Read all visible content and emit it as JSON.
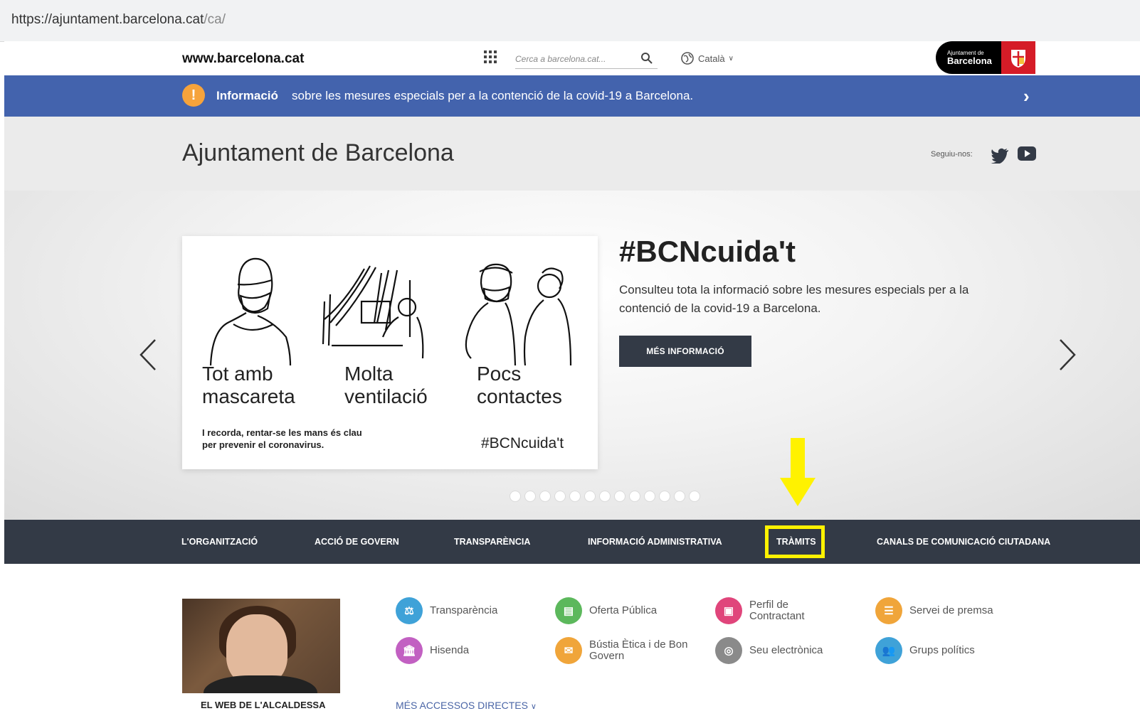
{
  "browser": {
    "url_host": "https://ajuntament.barcelona.cat",
    "url_path": "/ca/"
  },
  "topbar": {
    "site_label": "www.barcelona.cat",
    "search_placeholder": "Cerca a barcelona.cat...",
    "language": "Català",
    "logo_line1": "Ajuntament de",
    "logo_line2": "Barcelona"
  },
  "banner": {
    "title": "Informació",
    "text": "sobre les mesures especials per a la contenció de la covid-19 a Barcelona.",
    "color": "#4363ad"
  },
  "header": {
    "title": "Ajuntament de Barcelona",
    "follow_label": "Seguiu-nos:"
  },
  "hero": {
    "card": {
      "caption1_line1": "Tot amb",
      "caption1_line2": "mascareta",
      "caption2_line1": "Molta",
      "caption2_line2": "ventilació",
      "caption3_line1": "Pocs",
      "caption3_line2": "contactes",
      "note_line1": "I recorda, rentar-se les mans és clau",
      "note_line2": "per prevenir el coronavirus.",
      "hashtag": "#BCNcuida't"
    },
    "headline": "#BCNcuida't",
    "description": "Consulteu tota la informació sobre les mesures especials per a la contenció de la covid-19 a Barcelona.",
    "button": "MÉS INFORMACIÓ",
    "slide_count": 13
  },
  "nav": {
    "items": [
      "L'ORGANITZACIÓ",
      "ACCIÓ DE GOVERN",
      "TRANSPARÈNCIA",
      "INFORMACIÓ ADMINISTRATIVA",
      "TRÀMITS",
      "CANALS DE COMUNICACIÓ CIUTADANA"
    ],
    "highlighted": "TRÀMITS",
    "highlight_color": "#fff200"
  },
  "mayor": {
    "label": "EL WEB DE L'ALCALDESSA"
  },
  "access": {
    "items": [
      {
        "label": "Transparència",
        "icon": "transparency-icon",
        "color": "#3fa2d8"
      },
      {
        "label": "Oferta Pública",
        "icon": "document-icon",
        "color": "#5cb85c"
      },
      {
        "label": "Perfil de Contractant",
        "icon": "briefcase-icon",
        "color": "#e0457b"
      },
      {
        "label": "Servei de premsa",
        "icon": "press-icon",
        "color": "#f0a53a"
      },
      {
        "label": "Hisenda",
        "icon": "bank-icon",
        "color": "#c260c2"
      },
      {
        "label": "Bústia Ètica i de Bon Govern",
        "icon": "mailbox-icon",
        "color": "#f0a53a"
      },
      {
        "label": "Seu electrònica",
        "icon": "fingerprint-icon",
        "color": "#8a8a8a"
      },
      {
        "label": "Grups polítics",
        "icon": "people-icon",
        "color": "#3fa2d8"
      }
    ],
    "more": "MÉS ACCESSOS DIRECTES"
  }
}
